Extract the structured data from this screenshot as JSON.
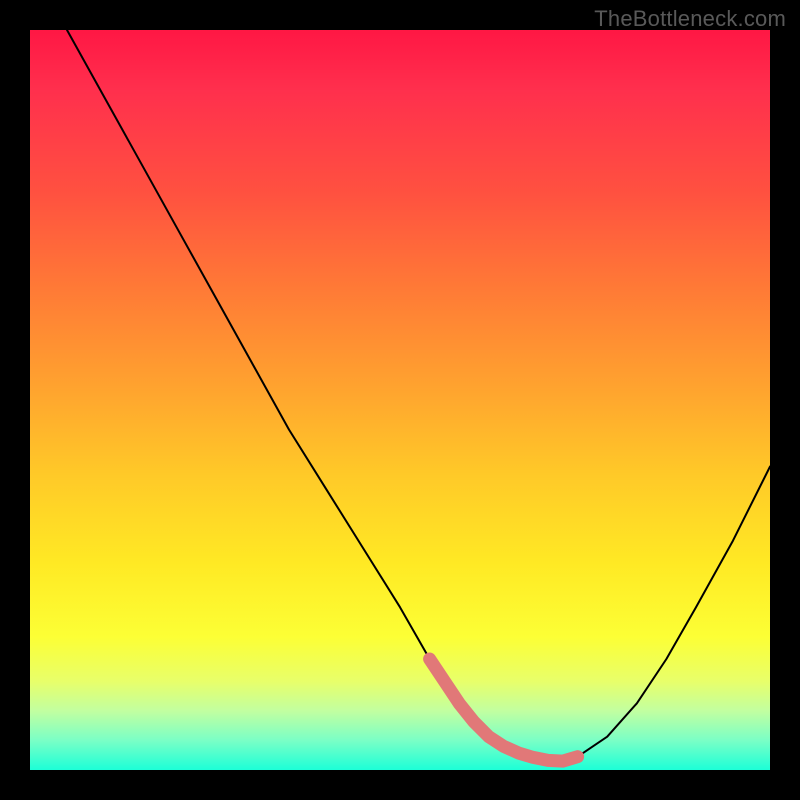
{
  "watermark": "TheBottleneck.com",
  "colors": {
    "background": "#000000",
    "gradient_top": "#ff1744",
    "gradient_mid": "#ffe924",
    "gradient_bottom": "#1cffd7",
    "curve": "#000000",
    "highlight": "#e17878"
  },
  "chart_data": {
    "type": "line",
    "title": "",
    "xlabel": "",
    "ylabel": "",
    "xlim": [
      0,
      100
    ],
    "ylim": [
      0,
      100
    ],
    "x": [
      5,
      10,
      15,
      20,
      25,
      30,
      35,
      40,
      45,
      50,
      54,
      56,
      58,
      60,
      62,
      64,
      66,
      68,
      70,
      72,
      74,
      78,
      82,
      86,
      90,
      95,
      100
    ],
    "values": [
      100,
      91,
      82,
      73,
      64,
      55,
      46,
      38,
      30,
      22,
      15,
      12,
      9,
      6.5,
      4.5,
      3.2,
      2.3,
      1.7,
      1.3,
      1.2,
      1.8,
      4.5,
      9,
      15,
      22,
      31,
      41
    ],
    "highlight_ranges": [
      {
        "x0": 54,
        "x1": 74
      }
    ],
    "legend": [],
    "annotations": []
  }
}
